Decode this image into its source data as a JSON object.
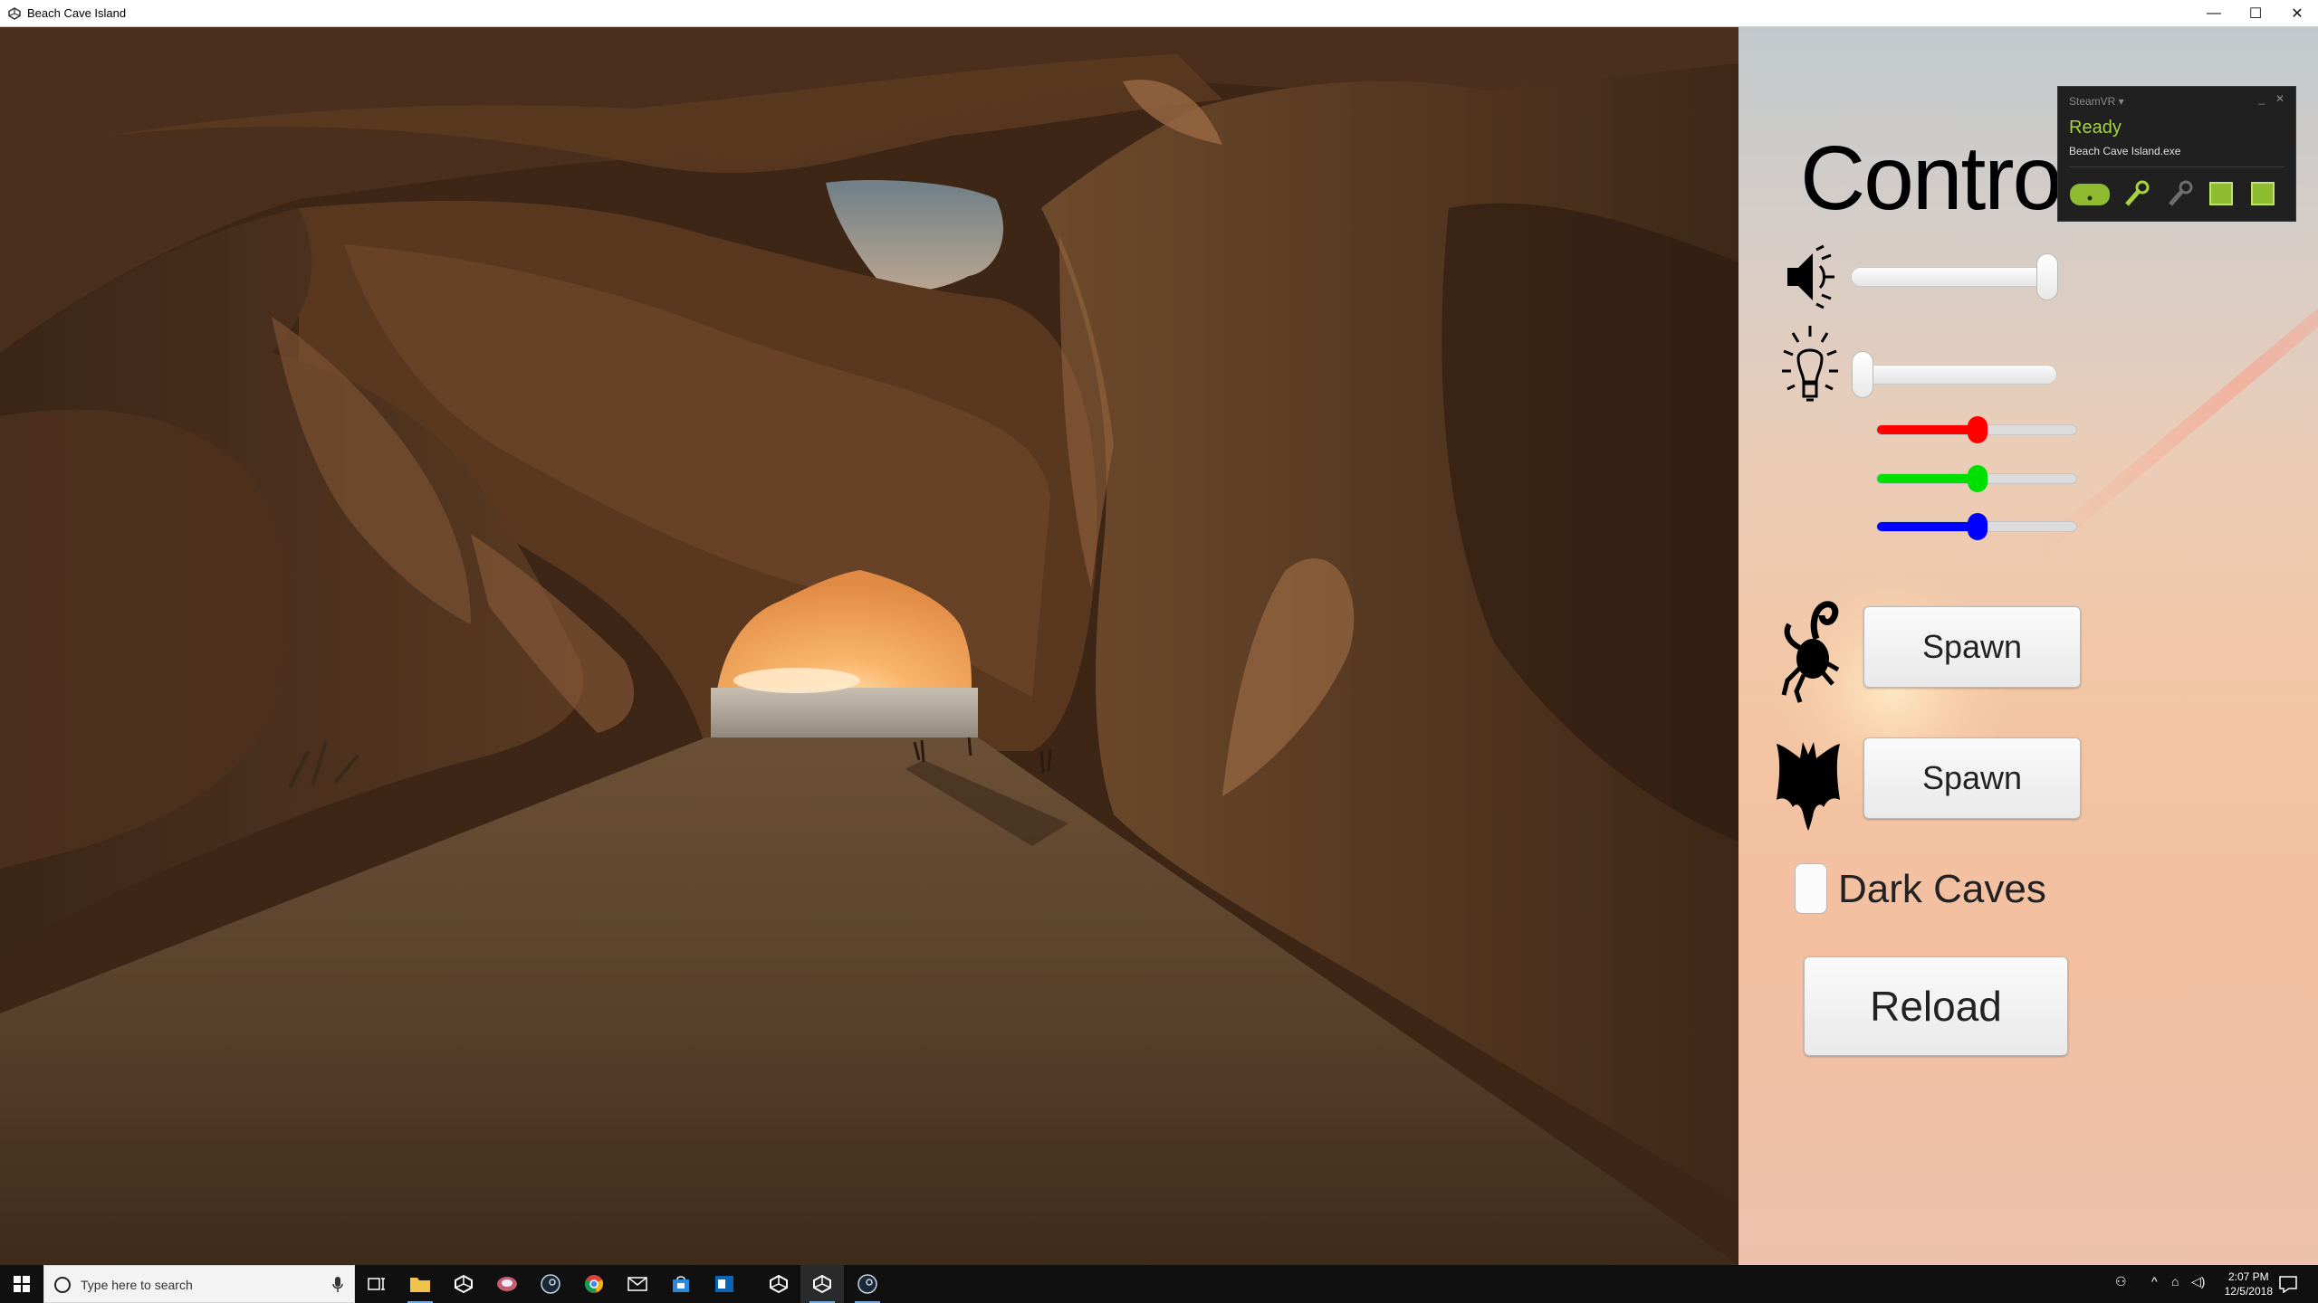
{
  "window": {
    "title": "Beach Cave Island",
    "controls": {
      "minimize": "—",
      "maximize": "☐",
      "close": "✕"
    }
  },
  "panel": {
    "title": "Controls",
    "volume": {
      "icon": "speaker-icon",
      "value": 1.0
    },
    "light": {
      "icon": "lightbulb-icon",
      "value": 0.0
    },
    "color": {
      "red": 0.5,
      "green": 0.5,
      "blue": 0.5,
      "colors": {
        "red": "#ff0000",
        "green": "#00e000",
        "blue": "#0000ff"
      }
    },
    "crab_spawn_label": "Spawn",
    "bat_spawn_label": "Spawn",
    "dark_caves": {
      "label": "Dark Caves",
      "checked": false
    },
    "reload_label": "Reload"
  },
  "steamvr": {
    "header": "SteamVR ▾",
    "minimize": "_",
    "close": "✕",
    "status": "Ready",
    "exe": "Beach Cave Island.exe",
    "accent": "#a4d63b"
  },
  "taskbar": {
    "search_placeholder": "Type here to search",
    "time": "2:07 PM",
    "date": "12/5/2018"
  }
}
